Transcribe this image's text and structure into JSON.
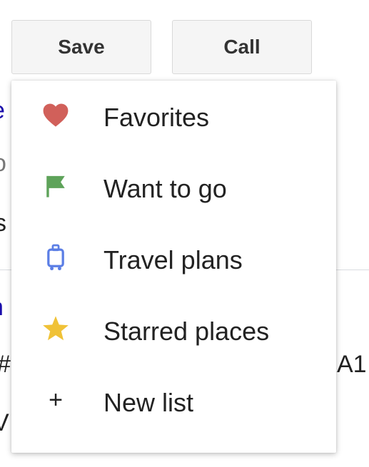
{
  "toolbar": {
    "save_label": "Save",
    "call_label": "Call"
  },
  "background": {
    "frag_1": "e",
    "frag_2": "o",
    "frag_3": "s",
    "frag_4": "n",
    "frag_5": "#",
    "frag_6": "V",
    "frag_7": "A1"
  },
  "menu": {
    "items": [
      {
        "label": "Favorites",
        "icon": "heart-icon",
        "icon_color": "#d1605a"
      },
      {
        "label": "Want to go",
        "icon": "flag-icon",
        "icon_color": "#5ea35a"
      },
      {
        "label": "Travel plans",
        "icon": "suitcase-icon",
        "icon_color": "#5b7ee5"
      },
      {
        "label": "Starred places",
        "icon": "star-icon",
        "icon_color": "#f0c237"
      },
      {
        "label": "New list",
        "icon": "plus-icon",
        "icon_color": "#222222"
      }
    ]
  }
}
